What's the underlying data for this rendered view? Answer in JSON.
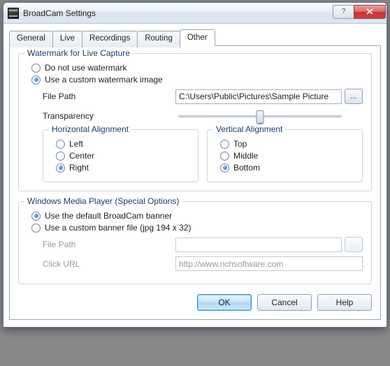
{
  "window": {
    "title": "BroadCam Settings"
  },
  "tabs": {
    "general": "General",
    "live": "Live",
    "recordings": "Recordings",
    "routing": "Routing",
    "other": "Other"
  },
  "watermark": {
    "group_title": "Watermark for Live Capture",
    "opt_none": "Do not use watermark",
    "opt_custom": "Use a custom watermark image",
    "selected": "custom",
    "file_path_label": "File Path",
    "file_path_value": "C:\\Users\\Public\\Pictures\\Sample Picture",
    "browse_label": "...",
    "transparency_label": "Transparency",
    "halign": {
      "title": "Horizontal Alignment",
      "left": "Left",
      "center": "Center",
      "right": "Right",
      "selected": "right"
    },
    "valign": {
      "title": "Vertical Alignment",
      "top": "Top",
      "middle": "Middle",
      "bottom": "Bottom",
      "selected": "bottom"
    }
  },
  "wmp": {
    "group_title": "Windows Media Player (Special Options)",
    "opt_default": "Use the default BroadCam banner",
    "opt_custom": "Use a custom banner file (jpg 194 x 32)",
    "selected": "default",
    "file_path_label": "File Path",
    "file_path_value": "",
    "browse_label": "...",
    "click_url_label": "Click URL",
    "click_url_value": "http://www.nchsoftware.com"
  },
  "buttons": {
    "ok": "OK",
    "cancel": "Cancel",
    "help": "Help"
  }
}
